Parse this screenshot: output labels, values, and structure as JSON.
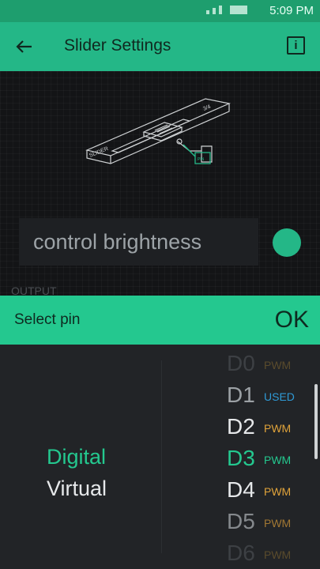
{
  "status_bar": {
    "time": "5:09 PM"
  },
  "app_bar": {
    "title": "Slider Settings",
    "info_label": "i"
  },
  "illustration": {
    "slider_label": "SLIDER",
    "fraction_label": "3/4",
    "pin_label": "PIN"
  },
  "widget_name": {
    "value": "control brightness"
  },
  "color_swatch": {
    "color": "#24b787"
  },
  "output": {
    "label": "OUTPUT"
  },
  "select_pin": {
    "title": "Select pin",
    "ok_label": "OK"
  },
  "pin_types": [
    {
      "label": "Digital",
      "selected": true
    },
    {
      "label": "Virtual",
      "selected": false
    }
  ],
  "pins": [
    {
      "name": "D0",
      "tag": "PWM",
      "state": "faded"
    },
    {
      "name": "D1",
      "tag": "USED",
      "state": "used"
    },
    {
      "name": "D2",
      "tag": "PWM",
      "state": "normal"
    },
    {
      "name": "D3",
      "tag": "PWM",
      "state": "selected"
    },
    {
      "name": "D4",
      "tag": "PWM",
      "state": "normal"
    },
    {
      "name": "D5",
      "tag": "PWM",
      "state": "dim"
    },
    {
      "name": "D6",
      "tag": "PWM",
      "state": "faded"
    }
  ],
  "colors": {
    "accent": "#24c88f",
    "pwm": "#e0a33a",
    "used": "#2f9ad6",
    "text": "#e6e8ea"
  }
}
